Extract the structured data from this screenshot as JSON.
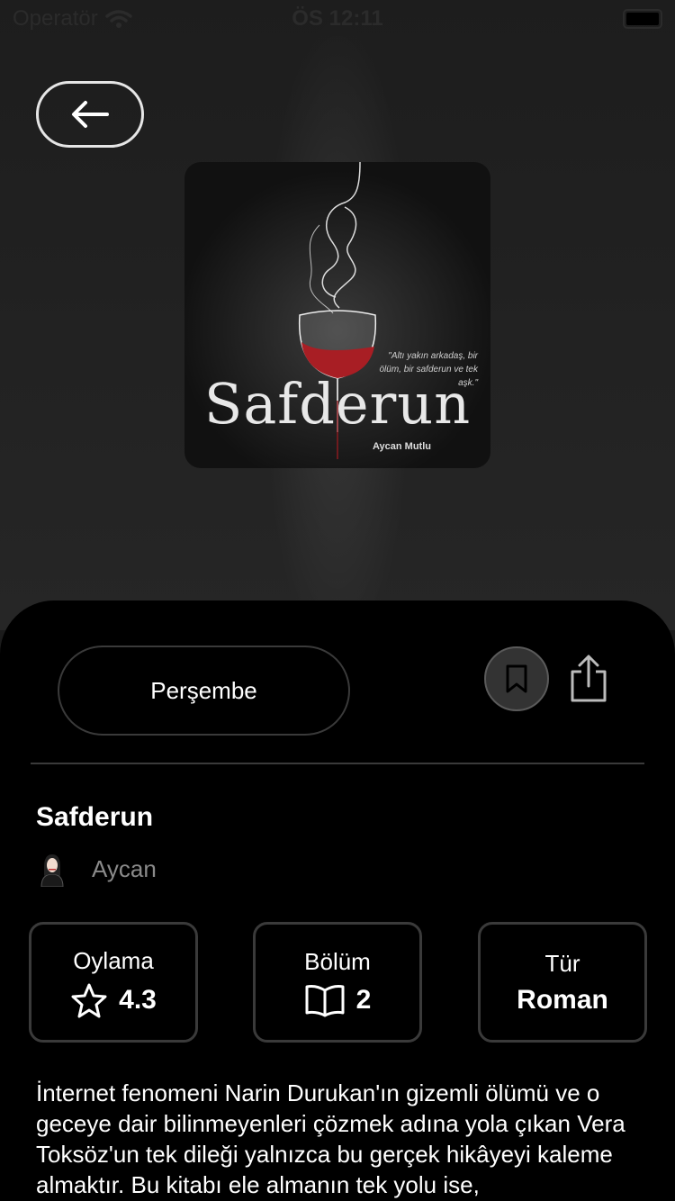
{
  "status_bar": {
    "carrier": "Operatör",
    "time": "ÖS 12:11"
  },
  "cover": {
    "title": "Safderun",
    "author": "Aycan Mutlu",
    "quote": "\"Altı yakın arkadaş, bir ölüm, bir safderun ve tek aşk.\""
  },
  "actions": {
    "day_label": "Perşembe"
  },
  "book": {
    "title": "Safderun",
    "author": "Aycan"
  },
  "stats": {
    "rating_label": "Oylama",
    "rating_value": "4.3",
    "chapters_label": "Bölüm",
    "chapters_value": "2",
    "genre_label": "Tür",
    "genre_value": "Roman"
  },
  "description": "İnternet fenomeni Narin Durukan'ın gizemli ölümü ve o geceye dair bilinmeyenleri çözmek adına yola çıkan Vera Toksöz'un tek dileği yalnızca bu gerçek hikâyeyi kaleme almaktır. Bu kitabı ele almanın tek yolu ise,",
  "icons": [
    "wifi-icon",
    "battery-icon",
    "arrow-left-icon",
    "bookmark-icon",
    "share-icon",
    "star-icon",
    "book-open-icon"
  ],
  "colors": {
    "sheet": "#000000",
    "background": "#1b1b1b",
    "border": "#3a3a3a",
    "muted_text": "#8a8a8a"
  }
}
